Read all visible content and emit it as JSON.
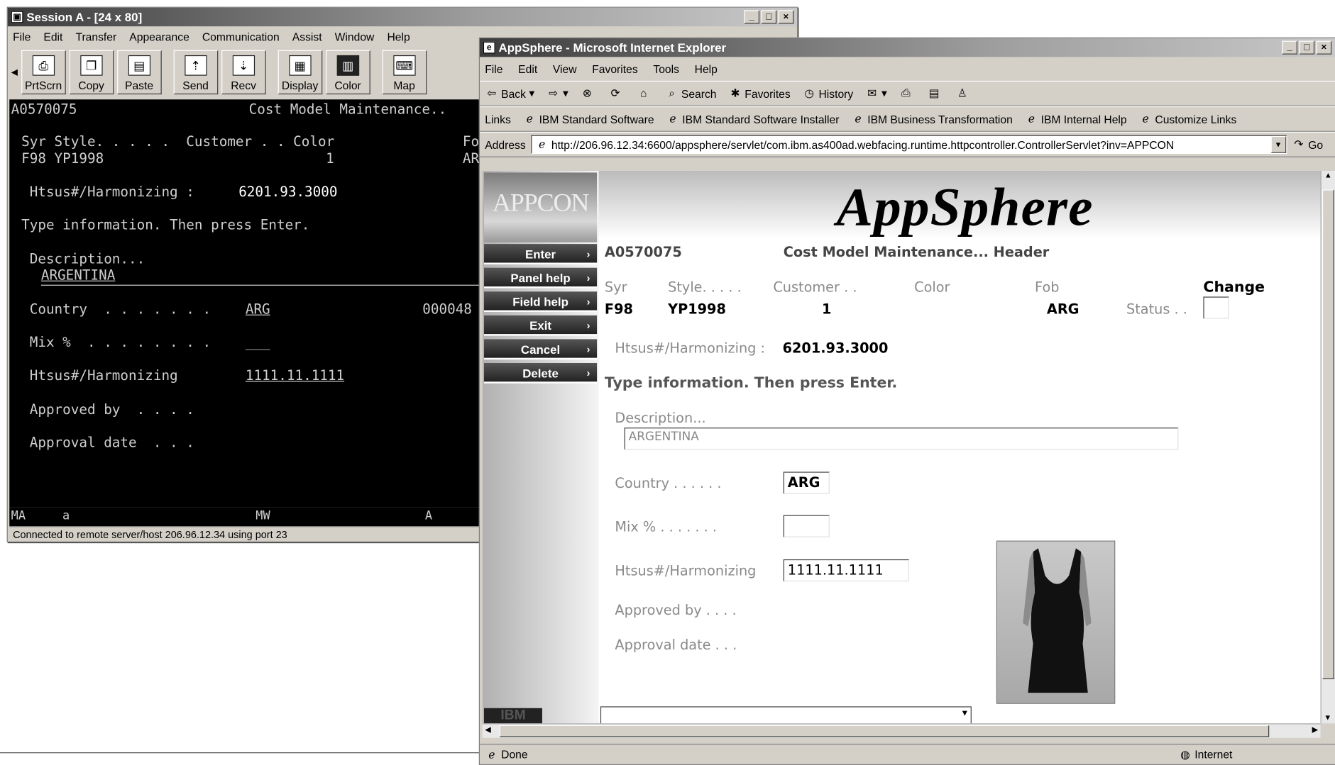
{
  "session": {
    "title": "Session A - [24 x 80]",
    "menu": [
      "File",
      "Edit",
      "Transfer",
      "Appearance",
      "Communication",
      "Assist",
      "Window",
      "Help"
    ],
    "toolbar": [
      "PrtScrn",
      "Copy",
      "Paste",
      "Send",
      "Recv",
      "Display",
      "Color",
      "Map"
    ],
    "terminal": {
      "line1_left": "A0570075",
      "line1_right": "Cost Model Maintenance..",
      "header_cols": "Syr Style. . . . .  Customer . . Color",
      "header_fob": "Fo",
      "values_row": "F98 YP1998",
      "customer_value": "1",
      "fob_value": "AR",
      "htsus_label": " Htsus#/Harmonizing : ",
      "htsus_value": "6201.93.3000",
      "instructions": "Type information. Then press Enter.",
      "description_label": " Description...",
      "description_value": "ARGENTINA",
      "country_label": " Country  . . . . . . .",
      "country_value": "ARG",
      "country_code": "000048",
      "mix_label": " Mix %  . . . . . . . .",
      "mix_value": "___",
      "htsus_input_label": " Htsus#/Harmonizing",
      "htsus_input_value": "1111.11.1111",
      "approved_label": " Approved by  . . . .",
      "approval_date_label": " Approval date  . . ."
    },
    "oia": {
      "ma": "MA",
      "a": "a",
      "mw": "MW",
      "A": "A"
    },
    "status": "Connected to remote server/host 206.96.12.34 using port 23"
  },
  "ie": {
    "title": "AppSphere - Microsoft Internet Explorer",
    "menu": [
      "File",
      "Edit",
      "View",
      "Favorites",
      "Tools",
      "Help"
    ],
    "nav": {
      "back": "Back",
      "search": "Search",
      "favorites": "Favorites",
      "history": "History"
    },
    "links_label": "Links",
    "links": [
      "IBM Standard Software",
      "IBM Standard Software Installer",
      "IBM Business Transformation",
      "IBM Internal Help",
      "Customize Links"
    ],
    "address_label": "Address",
    "address": "http://206.96.12.34:6600/appsphere/servlet/com.ibm.as400ad.webfacing.runtime.httpcontroller.ControllerServlet?inv=APPCON",
    "go": "Go",
    "status_left": "Done",
    "status_zone": "Internet"
  },
  "app": {
    "banner": "AppSphere",
    "logo": "APPCON",
    "sidebar": [
      "Enter",
      "Panel help",
      "Field help",
      "Exit",
      "Cancel",
      "Delete"
    ],
    "ibm": "IBM",
    "id": "A0570075",
    "header_title": "Cost Model Maintenance... Header",
    "col_syr": "Syr",
    "col_style": "Style. . . . .",
    "col_customer": "Customer . .",
    "col_color": "Color",
    "col_fob": "Fob",
    "change": "Change",
    "syr": "F98",
    "style": "YP1998",
    "customer": "1",
    "fob": "ARG",
    "status_label": "Status . .",
    "htsus_label": "Htsus#/Harmonizing :",
    "htsus_value": "6201.93.3000",
    "instructions": "Type information. Then press Enter.",
    "description_label": "Description...",
    "description_value": "ARGENTINA",
    "country_label": "Country  . . . . . .",
    "country_value": "ARG",
    "mix_label": "Mix %  . . . . . . .",
    "htsus_input_label": "Htsus#/Harmonizing",
    "htsus_input_value": "1111.11.1111",
    "approved_label": "Approved by  . . . .",
    "approval_date_label": "Approval date  . . ."
  }
}
